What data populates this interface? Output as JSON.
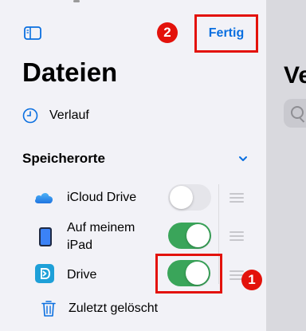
{
  "sidebar": {
    "title": "Dateien",
    "done_label": "Fertig",
    "recents_label": "Verlauf",
    "locations_header": "Speicherorte",
    "locations": [
      {
        "label": "iCloud Drive",
        "enabled": false,
        "icon": "cloud-icon"
      },
      {
        "label_line1": "Auf meinem",
        "label_line2": "iPad",
        "enabled": true,
        "icon": "ipad-icon"
      },
      {
        "label": "Drive",
        "enabled": true,
        "icon": "proton-drive-icon"
      }
    ],
    "recently_deleted_label": "Zuletzt gelöscht"
  },
  "annotations": {
    "badge_1": "1",
    "badge_2": "2",
    "highlight_color": "#e3120b"
  },
  "main": {
    "title_partial": "Ve"
  },
  "colors": {
    "accent": "#0a6fe0",
    "toggle_on": "#3aa55a",
    "toggle_off": "#e5e5ea"
  }
}
